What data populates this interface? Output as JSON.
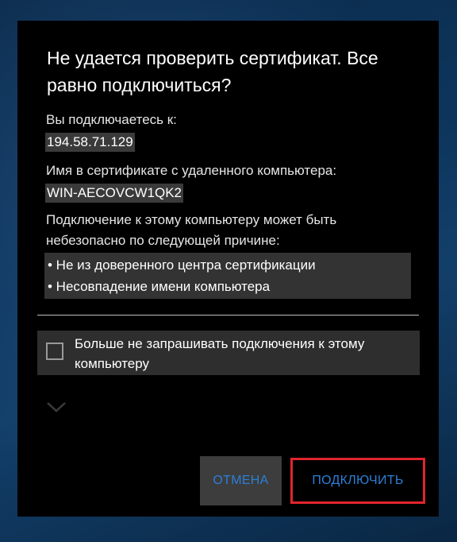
{
  "dialog": {
    "title": "Не удается проверить сертификат. Все равно подключиться?",
    "connecting_to_label": "Вы подключаетесь к:",
    "connecting_to_value": "194.58.71.129",
    "cert_name_label": "Имя в сертификате с удаленного компьютера:",
    "cert_name_value": "WIN-AECOVCW1QK2",
    "reason_intro": "Подключение к этому компьютеру может быть небезопасно по следующей причине:",
    "reasons": [
      "• Не из доверенного центра сертификации",
      "• Несовпадение имени компьютера"
    ],
    "dont_ask_label": "Больше не запрашивать подключения к этому компьютеру",
    "dont_ask_checked": false,
    "expand_icon": "chevron-down-icon",
    "cancel_label": "ОТМЕНА",
    "connect_label": "ПОДКЛЮЧИТЬ"
  },
  "colors": {
    "dialog_bg": "#000000",
    "accent_text": "#2d7fd6",
    "highlight_border": "#e0252c"
  }
}
